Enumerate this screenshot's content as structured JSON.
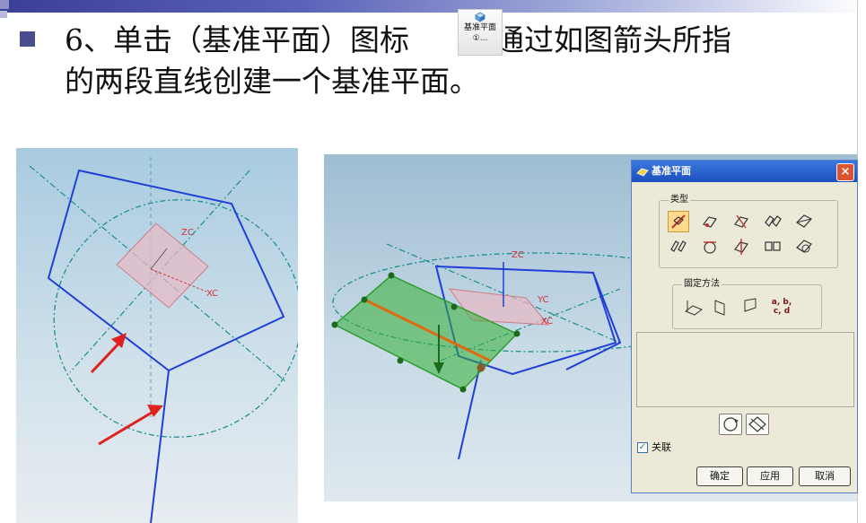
{
  "slide": {
    "line1_before": "6、单击（基准平面）图标",
    "line1_after": "，通过如图箭头所指",
    "line2": "的两段直线创建一个基准平面。"
  },
  "toolbar_icon": {
    "label": "基准平面",
    "sublabel": "①..."
  },
  "viewport_left": {
    "axis_z": "ZC",
    "axis_x": "XC"
  },
  "viewport_right": {
    "axis_z": "ZC",
    "axis_y": "YC",
    "axis_x": "XC"
  },
  "dialog": {
    "title": "基准平面",
    "close": "×",
    "group_type": "类型",
    "group_fixed": "固定方法",
    "fixed_abcd": "a, b, c, d",
    "associative": "关联",
    "associative_checked": true,
    "buttons": {
      "ok": "确定",
      "apply": "应用",
      "cancel": "取消"
    }
  },
  "colors": {
    "accent": "#4b4e8c",
    "selection": "#ffd98c",
    "plane_green": "#2e9e2e",
    "arrow_red": "#e0211d",
    "geometry_blue": "#1f3fd6"
  }
}
